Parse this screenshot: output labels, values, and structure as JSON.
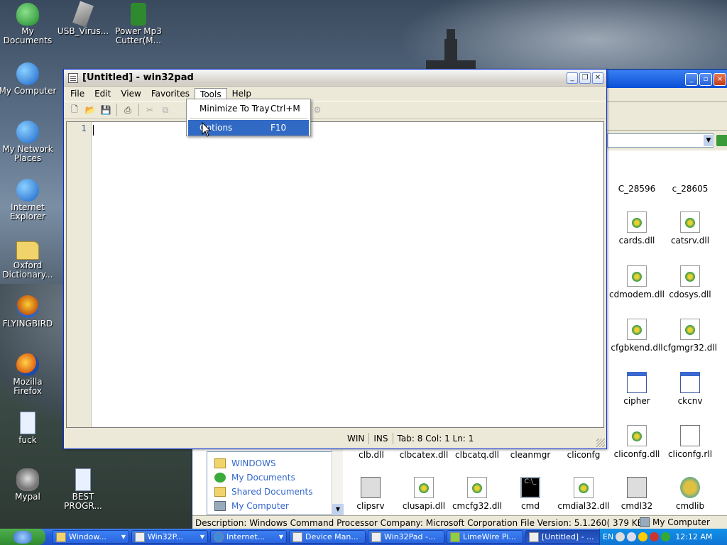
{
  "desktop": {
    "icons": [
      {
        "label": "My Documents"
      },
      {
        "label": "USB_Virus..."
      },
      {
        "label": "Power Mp3 Cutter(M..."
      },
      {
        "label": "My Computer"
      },
      {
        "label": "My Network Places"
      },
      {
        "label": "Internet Explorer"
      },
      {
        "label": "Oxford Dictionary..."
      },
      {
        "label": "FLYINGBIRD"
      },
      {
        "label": "Mozilla Firefox"
      },
      {
        "label": "fuck"
      },
      {
        "label": "Mypal"
      },
      {
        "label": "BEST PROGR..."
      }
    ]
  },
  "explorer": {
    "tree": [
      {
        "label": "WINDOWS"
      },
      {
        "label": "My Documents"
      },
      {
        "label": "Shared Documents"
      },
      {
        "label": "My Computer"
      }
    ],
    "files": [
      {
        "name": "C_28596"
      },
      {
        "name": "c_28605"
      },
      {
        "name": "cards.dll"
      },
      {
        "name": "catsrv.dll"
      },
      {
        "name": "cdmodem.dll"
      },
      {
        "name": "cdosys.dll"
      },
      {
        "name": "cfgbkend.dll"
      },
      {
        "name": "cfgmgr32.dll"
      },
      {
        "name": "cipher"
      },
      {
        "name": "ckcnv"
      },
      {
        "name": "cliconfg.dll"
      },
      {
        "name": "cliconfg.rll"
      },
      {
        "name": "clb.dll"
      },
      {
        "name": "clbcatex.dll"
      },
      {
        "name": "clbcatq.dll"
      },
      {
        "name": "cleanmgr"
      },
      {
        "name": "cliconfg"
      },
      {
        "name": "clipsrv"
      },
      {
        "name": "clusapi.dll"
      },
      {
        "name": "cmcfg32.dll"
      },
      {
        "name": "cmd"
      },
      {
        "name": "cmdial32.dll"
      },
      {
        "name": "cmdl32"
      },
      {
        "name": "cmdlib"
      }
    ],
    "status": "Description: Windows Command Processor Company: Microsoft Corporation File Version: 5.1.260( 379 KB",
    "status_right": "My Computer"
  },
  "win32pad": {
    "title": "[Untitled] - win32pad",
    "menus": [
      "File",
      "Edit",
      "View",
      "Favorites",
      "Tools",
      "Help"
    ],
    "gutter_line": "1",
    "status": {
      "mode": "WIN",
      "ins": "INS",
      "pos": "Tab: 8 Col: 1 Ln: 1"
    },
    "tools_menu": [
      {
        "label": "Minimize To Tray",
        "shortcut": "Ctrl+M"
      },
      {
        "label": "Options",
        "shortcut": "F10"
      }
    ]
  },
  "taskbar": {
    "tasks": [
      {
        "label": "Window..."
      },
      {
        "label": "Win32P..."
      },
      {
        "label": "Internet..."
      },
      {
        "label": "Device Man..."
      },
      {
        "label": "Win32Pad -..."
      },
      {
        "label": "LimeWire Pi..."
      },
      {
        "label": "[Untitled] - ..."
      }
    ],
    "lang": "EN",
    "clock": "12:12 AM"
  }
}
